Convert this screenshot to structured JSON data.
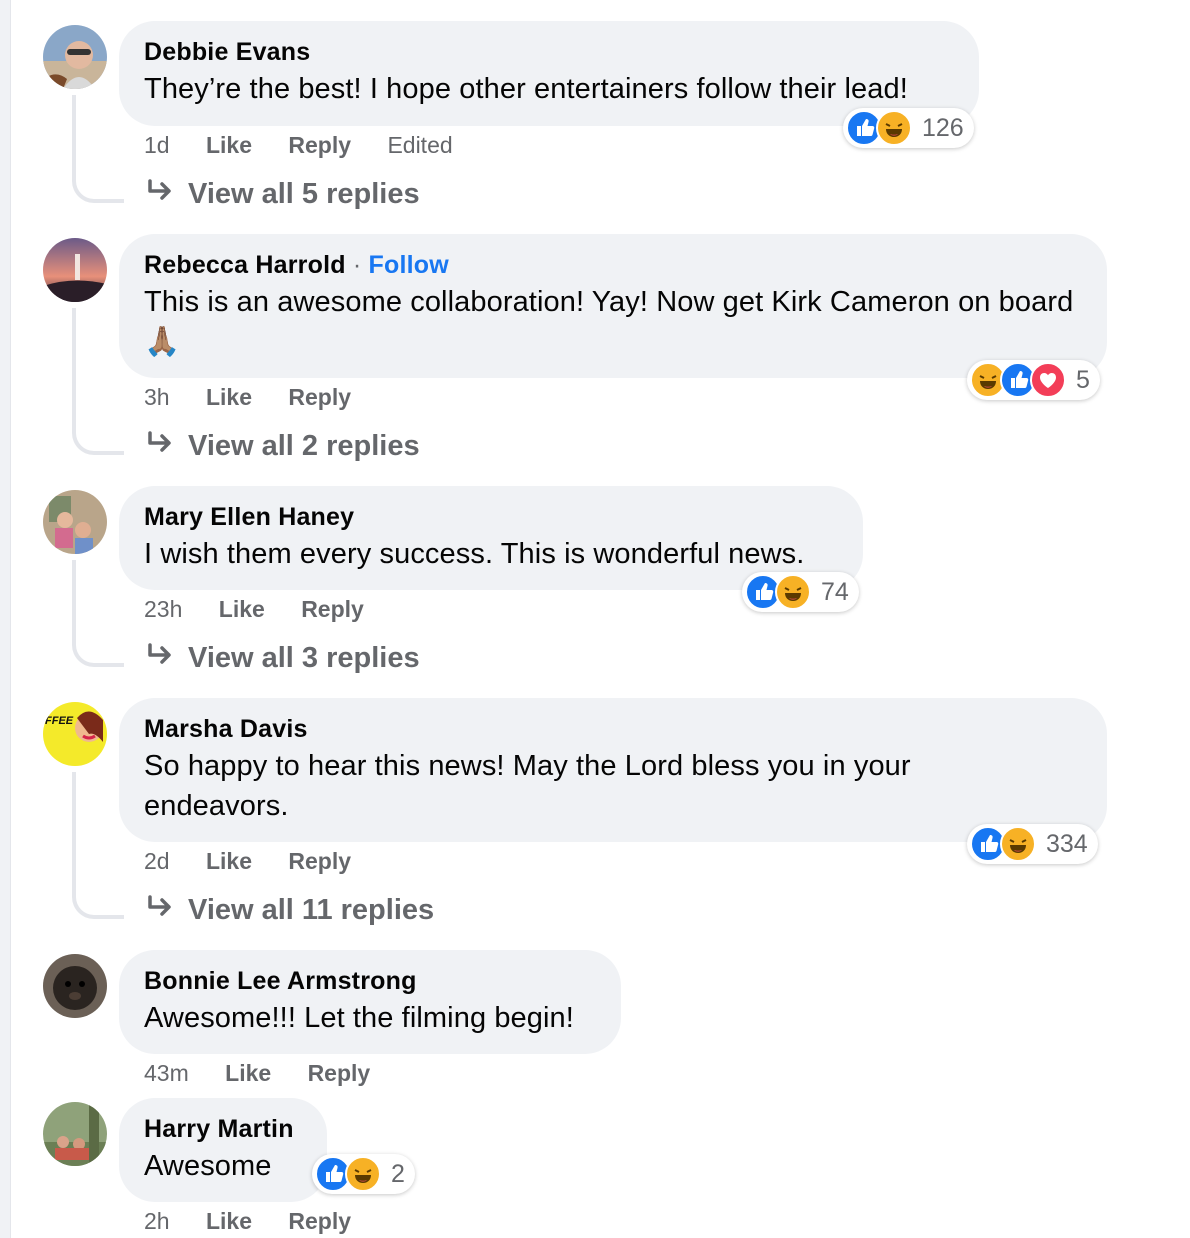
{
  "comments": [
    {
      "author": "Debbie Evans",
      "text": "They’re the best! I hope other entertainers follow their lead!",
      "time": "1d",
      "like": "Like",
      "reply": "Reply",
      "edited": "Edited",
      "reaction_count": "126",
      "view_replies": "View all 5 replies"
    },
    {
      "author": "Rebecca Harrold",
      "follow_sep": "·",
      "follow": "Follow",
      "text": "This is an awesome collaboration! Yay! Now get Kirk Cameron on board 🙏🏽",
      "time": "3h",
      "like": "Like",
      "reply": "Reply",
      "reaction_count": "5",
      "view_replies": "View all 2 replies"
    },
    {
      "author": "Mary Ellen Haney",
      "text": "I wish them every success. This is wonderful news.",
      "time": "23h",
      "like": "Like",
      "reply": "Reply",
      "reaction_count": "74",
      "view_replies": "View all 3 replies"
    },
    {
      "author": "Marsha Davis",
      "text": "So happy to hear this news! May the Lord bless you in your endeavors.",
      "time": "2d",
      "like": "Like",
      "reply": "Reply",
      "reaction_count": "334",
      "view_replies": "View all 11 replies"
    },
    {
      "author": "Bonnie Lee Armstrong",
      "text": "Awesome!!! Let the filming begin!",
      "time": "43m",
      "like": "Like",
      "reply": "Reply"
    },
    {
      "author": "Harry Martin",
      "text": "Awesome",
      "time": "2h",
      "like": "Like",
      "reply": "Reply",
      "reaction_count": "2"
    }
  ],
  "avatar_badge_text": "FFEE",
  "colors": {
    "accent": "#1877f2",
    "bubble": "#f0f2f5",
    "muted": "#65676b",
    "haha": "#f7b125",
    "love": "#f33e58"
  },
  "icons": [
    "like-reaction-icon",
    "haha-reaction-icon",
    "love-reaction-icon",
    "reply-arrow-icon"
  ]
}
